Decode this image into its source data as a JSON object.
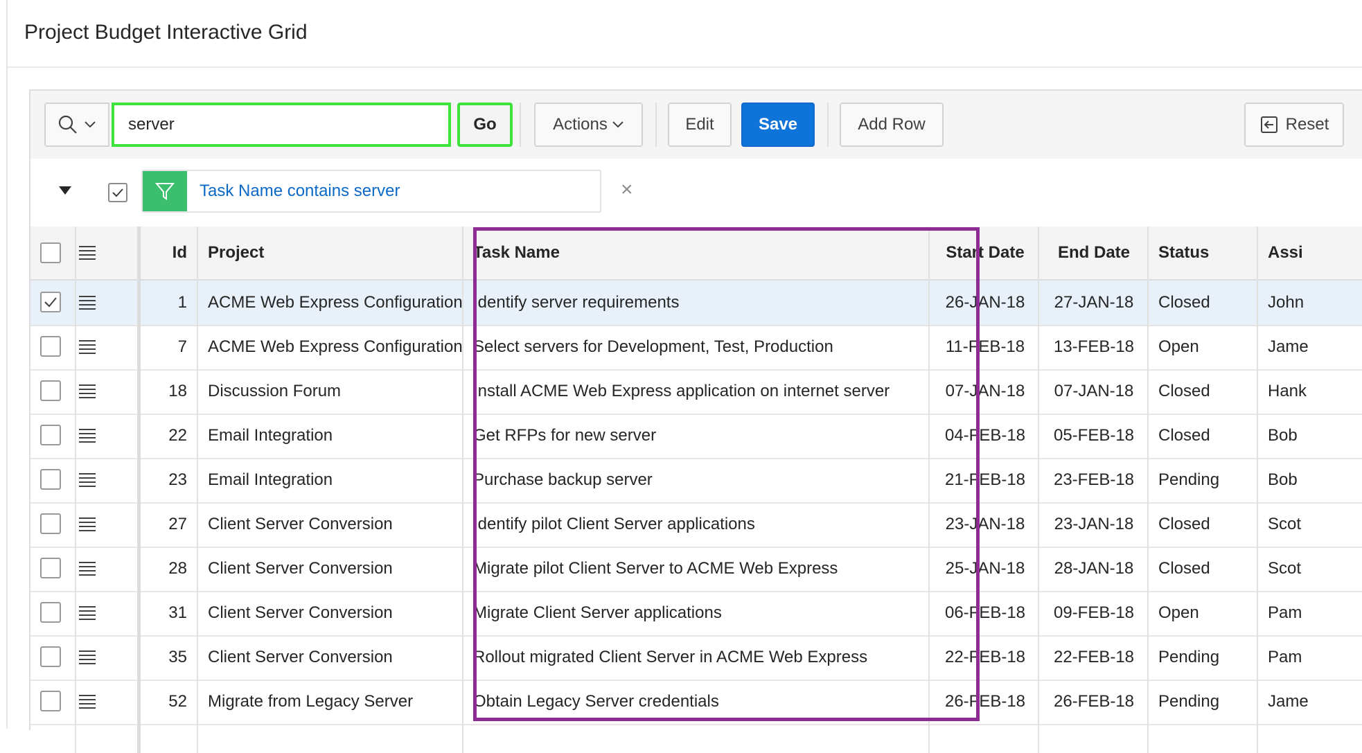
{
  "region": {
    "title": "Project Budget Interactive Grid"
  },
  "toolbar": {
    "search_value": "server",
    "go_label": "Go",
    "actions_label": "Actions",
    "edit_label": "Edit",
    "save_label": "Save",
    "add_row_label": "Add Row",
    "reset_label": "Reset",
    "save_color": "#0f74d9"
  },
  "filter": {
    "text": "Task Name contains server",
    "enabled": true,
    "remove_symbol": "×",
    "icon_color": "#3bbf6f"
  },
  "grid": {
    "columns": [
      "Id",
      "Project",
      "Task Name",
      "Start Date",
      "End Date",
      "Status",
      "Assi"
    ],
    "rows": [
      {
        "selected": true,
        "id": "1",
        "project": "ACME Web Express Configuration",
        "task": "Identify server requirements",
        "start": "26-JAN-18",
        "end": "27-JAN-18",
        "status": "Closed",
        "assignee": "John"
      },
      {
        "selected": false,
        "id": "7",
        "project": "ACME Web Express Configuration",
        "task": "Select servers for Development, Test, Production",
        "start": "11-FEB-18",
        "end": "13-FEB-18",
        "status": "Open",
        "assignee": "Jame"
      },
      {
        "selected": false,
        "id": "18",
        "project": "Discussion Forum",
        "task": "Install ACME Web Express application on internet server",
        "start": "07-JAN-18",
        "end": "07-JAN-18",
        "status": "Closed",
        "assignee": "Hank"
      },
      {
        "selected": false,
        "id": "22",
        "project": "Email Integration",
        "task": "Get RFPs for new server",
        "start": "04-FEB-18",
        "end": "05-FEB-18",
        "status": "Closed",
        "assignee": "Bob"
      },
      {
        "selected": false,
        "id": "23",
        "project": "Email Integration",
        "task": "Purchase backup server",
        "start": "21-FEB-18",
        "end": "23-FEB-18",
        "status": "Pending",
        "assignee": "Bob"
      },
      {
        "selected": false,
        "id": "27",
        "project": "Client Server Conversion",
        "task": "Identify pilot Client Server applications",
        "start": "23-JAN-18",
        "end": "23-JAN-18",
        "status": "Closed",
        "assignee": "Scot"
      },
      {
        "selected": false,
        "id": "28",
        "project": "Client Server Conversion",
        "task": "Migrate pilot Client Server to ACME Web Express",
        "start": "25-JAN-18",
        "end": "28-JAN-18",
        "status": "Closed",
        "assignee": "Scot"
      },
      {
        "selected": false,
        "id": "31",
        "project": "Client Server Conversion",
        "task": "Migrate Client Server applications",
        "start": "06-FEB-18",
        "end": "09-FEB-18",
        "status": "Open",
        "assignee": "Pam"
      },
      {
        "selected": false,
        "id": "35",
        "project": "Client Server Conversion",
        "task": "Rollout migrated Client Server in ACME Web Express",
        "start": "22-FEB-18",
        "end": "22-FEB-18",
        "status": "Pending",
        "assignee": "Pam"
      },
      {
        "selected": false,
        "id": "52",
        "project": "Migrate from Legacy Server",
        "task": "Obtain Legacy Server credentials",
        "start": "26-FEB-18",
        "end": "26-FEB-18",
        "status": "Pending",
        "assignee": "Jame"
      }
    ]
  }
}
